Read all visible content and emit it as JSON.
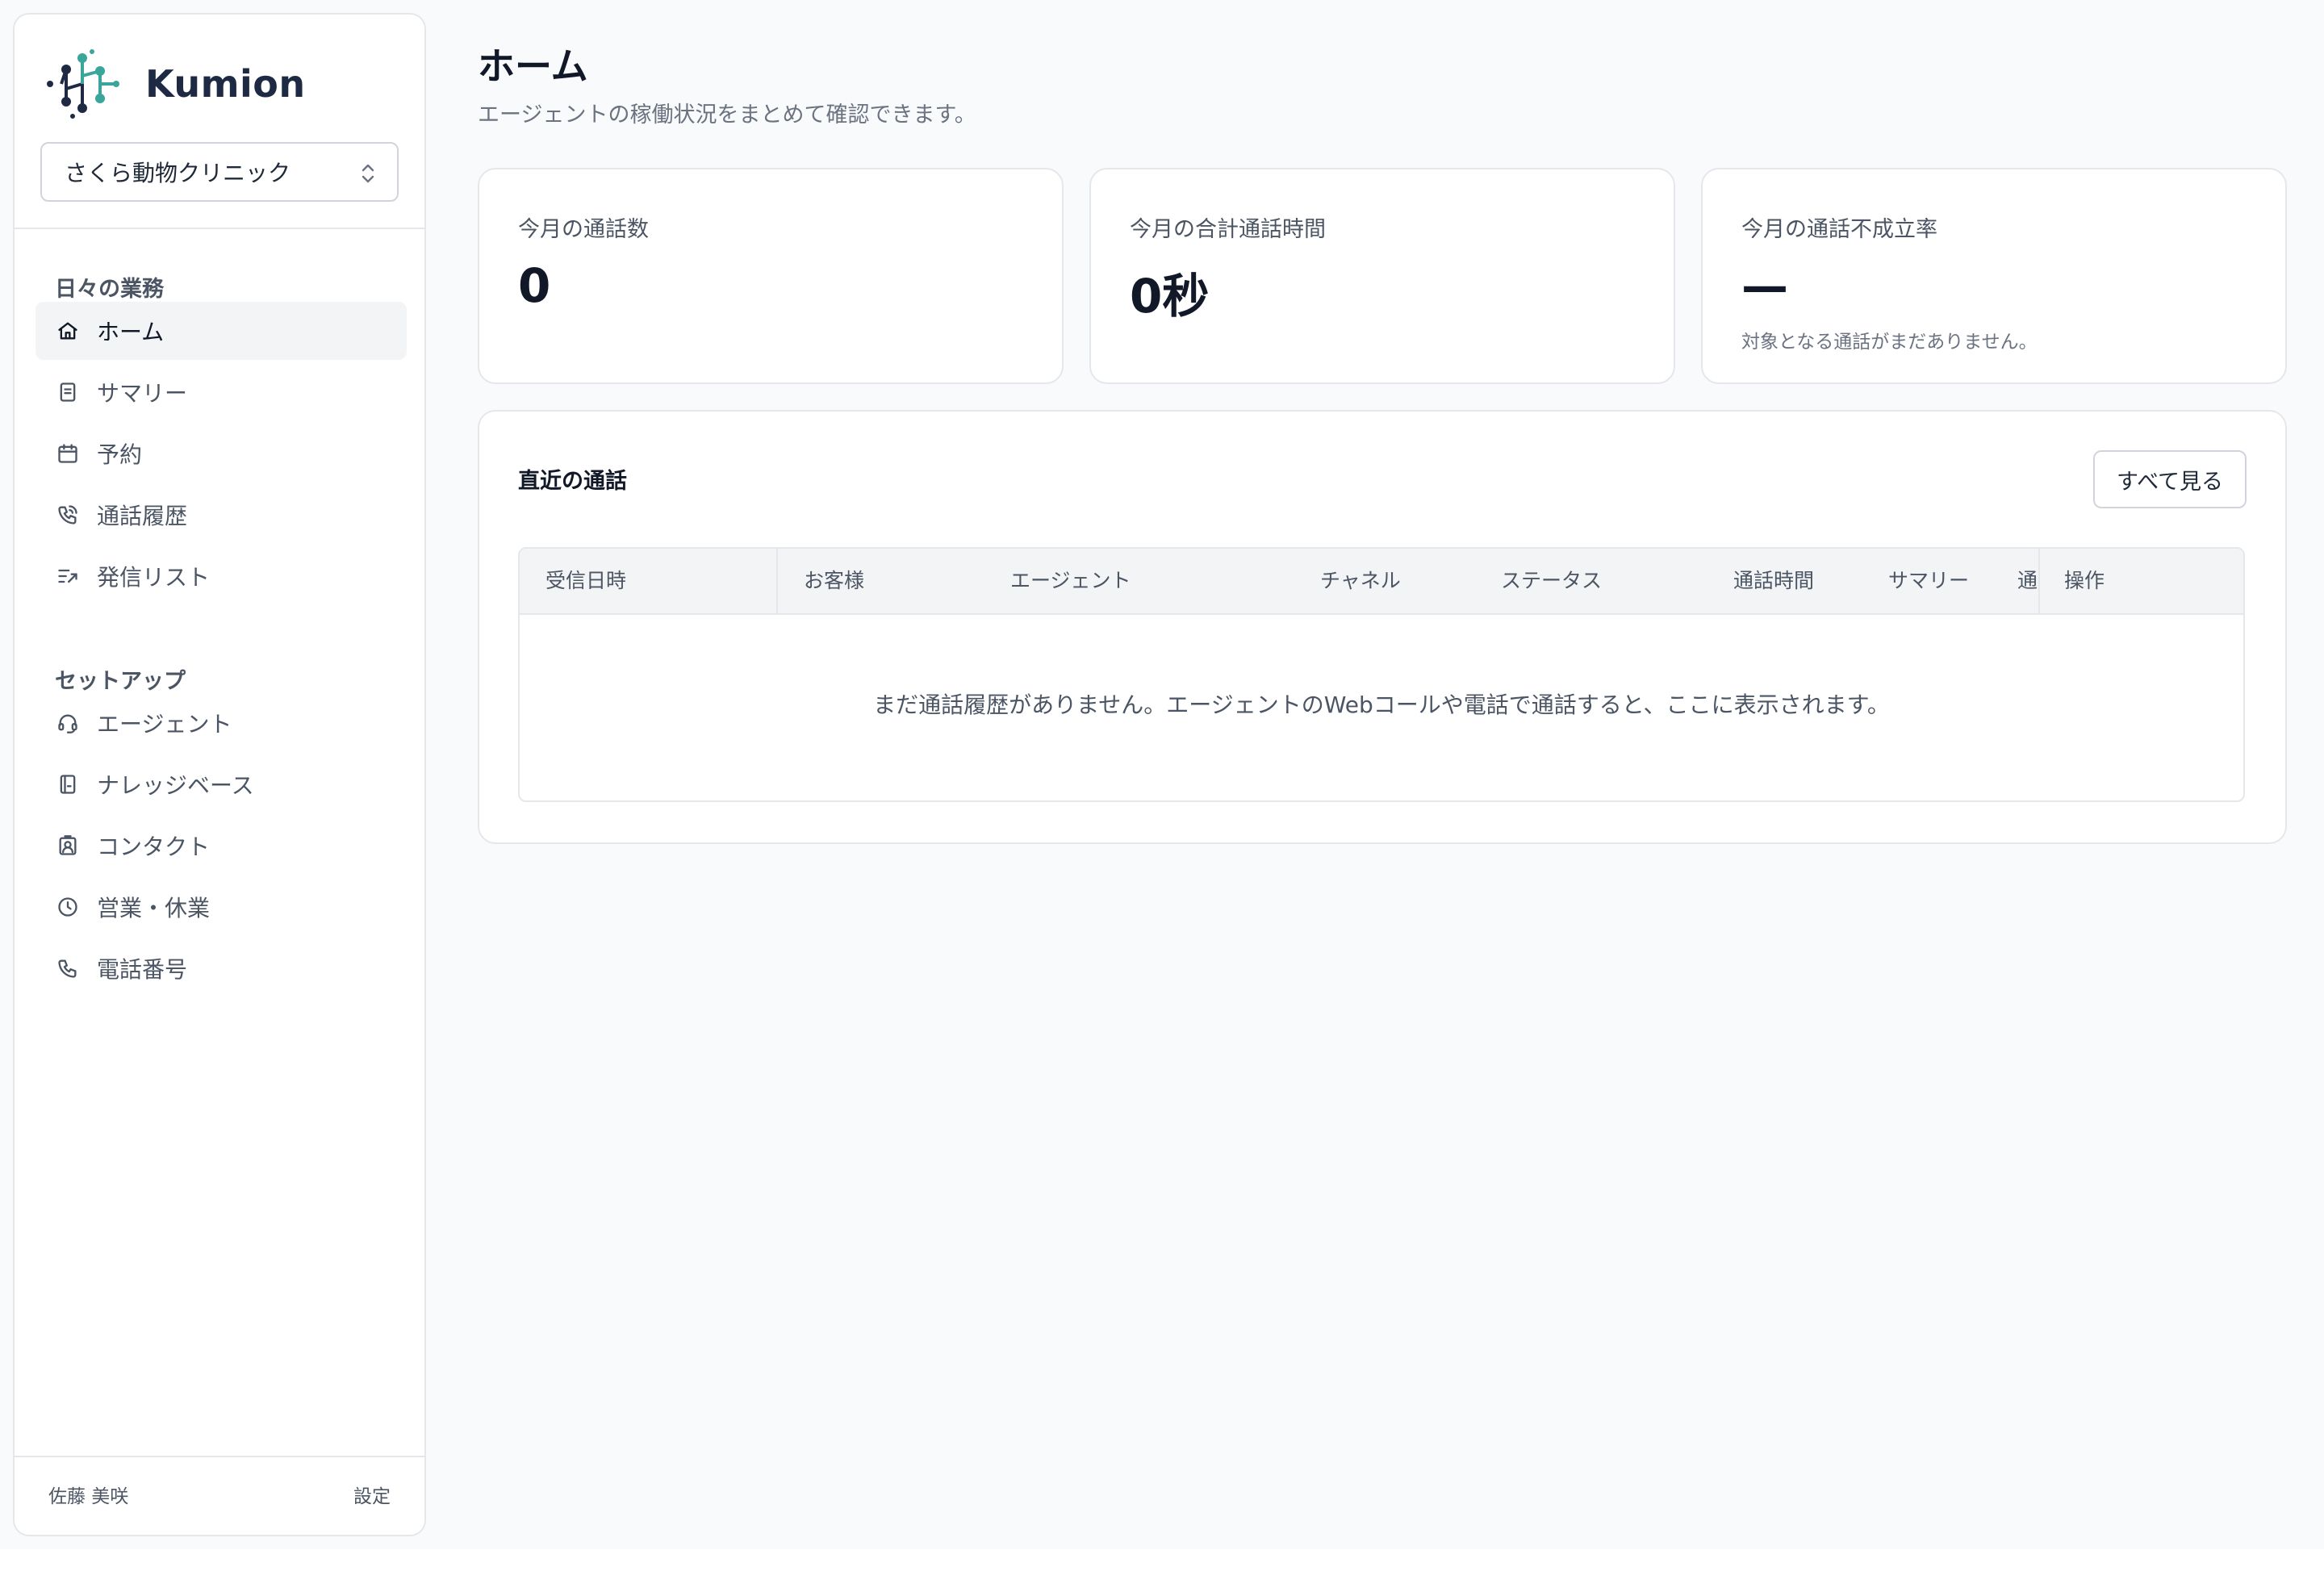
{
  "app": {
    "brand": "Kumion"
  },
  "sidebar": {
    "org_select": "さくら動物クリニック",
    "sections": [
      {
        "title": "日々の業務",
        "items": [
          {
            "label": "ホーム",
            "icon": "home-icon",
            "active": true
          },
          {
            "label": "サマリー",
            "icon": "document-icon"
          },
          {
            "label": "予約",
            "icon": "calendar-icon"
          },
          {
            "label": "通話履歴",
            "icon": "phone-history-icon"
          },
          {
            "label": "発信リスト",
            "icon": "outbound-list-icon"
          }
        ]
      },
      {
        "title": "セットアップ",
        "items": [
          {
            "label": "エージェント",
            "icon": "headset-icon"
          },
          {
            "label": "ナレッジベース",
            "icon": "book-icon"
          },
          {
            "label": "コンタクト",
            "icon": "contact-card-icon"
          },
          {
            "label": "営業・休業",
            "icon": "clock-icon"
          },
          {
            "label": "電話番号",
            "icon": "phone-icon"
          }
        ]
      }
    ],
    "footer": {
      "user": "佐藤 美咲",
      "settings": "設定"
    }
  },
  "main": {
    "title": "ホーム",
    "subtitle": "エージェントの稼働状況をまとめて確認できます。",
    "stats": [
      {
        "label": "今月の通話数",
        "value": "0"
      },
      {
        "label": "今月の合計通話時間",
        "value": "0秒"
      },
      {
        "label": "今月の通話不成立率",
        "value": "—",
        "note": "対象となる通話がまだありません。"
      }
    ],
    "recent_calls": {
      "title": "直近の通話",
      "see_all": "すべて見る",
      "columns": [
        "受信日時",
        "お客様",
        "エージェント",
        "チャネル",
        "ステータス",
        "通話時間",
        "サマリー",
        "通",
        "操作"
      ],
      "empty_message": "まだ通話履歴がありません。エージェントのWebコールや電話で通話すると、ここに表示されます。"
    }
  },
  "colors": {
    "brand_teal": "#3aa59a",
    "brand_navy": "#1e2a44",
    "background": "#f9fafb"
  }
}
